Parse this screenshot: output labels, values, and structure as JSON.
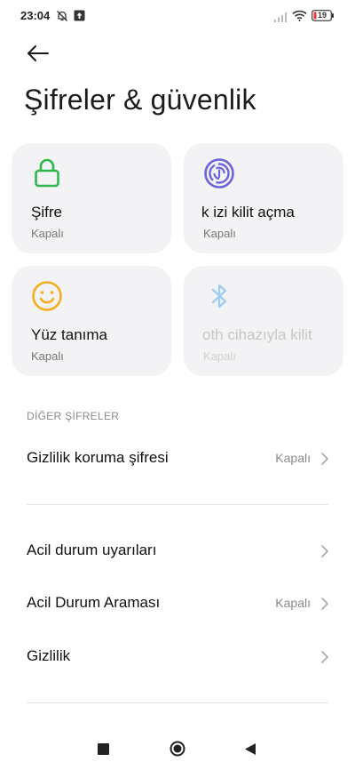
{
  "status_bar": {
    "time": "23:04",
    "battery": "19",
    "icons": [
      "notifications-muted-icon",
      "upload-icon",
      "signal-icon",
      "wifi-icon",
      "battery-icon"
    ]
  },
  "header": {
    "back_icon": "arrow-left-icon",
    "title": "Şifreler & güvenlik"
  },
  "cards": [
    {
      "icon": "lock-icon",
      "title": "Şifre",
      "status": "Kapalı",
      "enabled": true,
      "accent": "#2fb84a"
    },
    {
      "icon": "fingerprint-icon",
      "title": "k izi kilit açma",
      "status": "Kapalı",
      "enabled": true,
      "accent": "#6e63d8"
    },
    {
      "icon": "smiley-face-icon",
      "title": "Yüz tanıma",
      "status": "Kapalı",
      "enabled": true,
      "accent": "#f2b01e"
    },
    {
      "icon": "bluetooth-icon",
      "title": "oth cihazıyla kilit",
      "status": "Kapalı",
      "enabled": false,
      "accent": "#9ecdf2"
    }
  ],
  "sections": {
    "other_passwords": {
      "header": "DİĞER ŞİFRELER",
      "items": [
        {
          "label": "Gizlilik koruma şifresi",
          "value": "Kapalı"
        }
      ]
    },
    "emergency": {
      "items": [
        {
          "label": "Acil durum uyarıları",
          "value": ""
        },
        {
          "label": "Acil Durum Araması",
          "value": "Kapalı"
        },
        {
          "label": "Gizlilik",
          "value": ""
        }
      ]
    }
  },
  "nav_bar": {
    "buttons": [
      "recents-square-icon",
      "home-circle-icon",
      "back-triangle-icon"
    ]
  }
}
